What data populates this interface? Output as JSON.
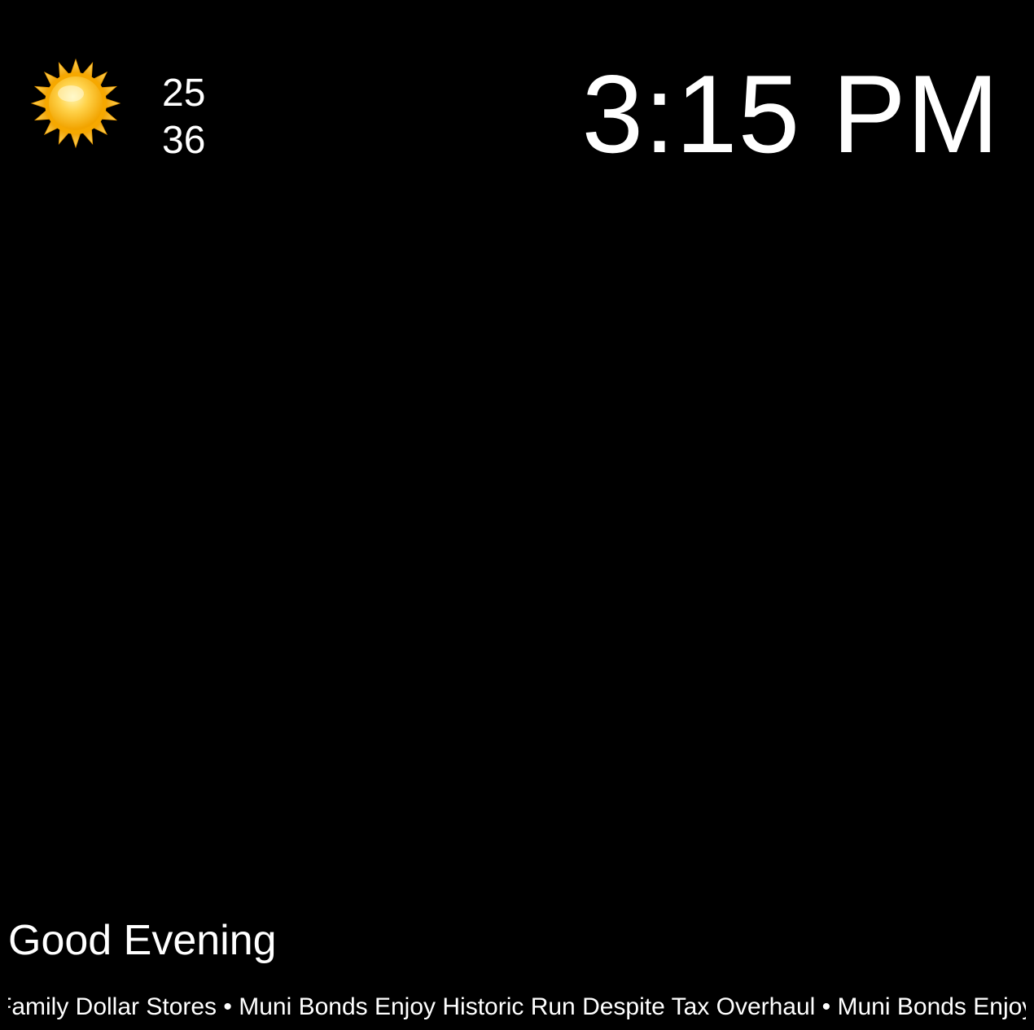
{
  "weather": {
    "icon": "sun-icon",
    "temp_current": "25",
    "temp_second": "36"
  },
  "clock": {
    "time": "3:15 PM"
  },
  "greeting": {
    "text": "Good Evening"
  },
  "news_ticker": {
    "text": "Family Dollar Stores • Muni Bonds Enjoy Historic Run Despite Tax Overhaul • Muni Bonds Enjoy"
  },
  "colors": {
    "background": "#000000",
    "text": "#ffffff",
    "sun": "#f5b700"
  }
}
